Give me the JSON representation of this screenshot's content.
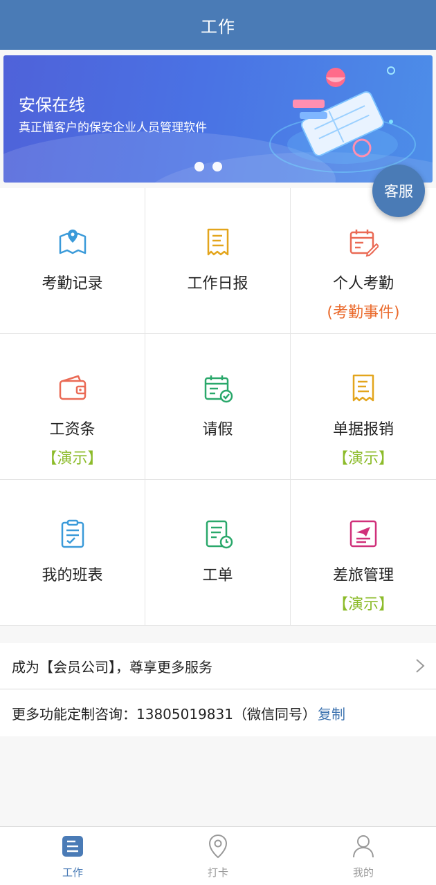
{
  "header": {
    "title": "工作"
  },
  "banner": {
    "title": "安保在线",
    "subtitle": "真正懂客户的保安企业人员管理软件",
    "slides": 2
  },
  "floating": {
    "kefu_label": "客服"
  },
  "grid": {
    "items": [
      {
        "label": "考勤记录",
        "icon": "map-pin-icon",
        "sub": ""
      },
      {
        "label": "工作日报",
        "icon": "report-doc-icon",
        "sub": ""
      },
      {
        "label": "个人考勤",
        "icon": "calendar-edit-icon",
        "sub": "(考勤事件)"
      },
      {
        "label": "工资条",
        "icon": "wallet-icon",
        "sub": "【演示】"
      },
      {
        "label": "请假",
        "icon": "calendar-check-icon",
        "sub": ""
      },
      {
        "label": "单据报销",
        "icon": "receipt-icon",
        "sub": "【演示】"
      },
      {
        "label": "我的班表",
        "icon": "clipboard-check-icon",
        "sub": ""
      },
      {
        "label": "工单",
        "icon": "work-order-clock-icon",
        "sub": ""
      },
      {
        "label": "差旅管理",
        "icon": "travel-plane-icon",
        "sub": "【演示】"
      }
    ]
  },
  "member": {
    "text": "成为【会员公司】，尊享更多服务"
  },
  "consult": {
    "text": "更多功能定制咨询：13805019831（微信同号）",
    "copy_label": "复制"
  },
  "tabbar": {
    "tabs": [
      {
        "label": "工作",
        "icon": "work-list-icon",
        "active": true
      },
      {
        "label": "打卡",
        "icon": "location-pin-icon",
        "active": false
      },
      {
        "label": "我的",
        "icon": "user-icon",
        "active": false
      }
    ]
  },
  "colors": {
    "primary": "#4a7bb6",
    "orange_sub": "#ea6a2c",
    "green_sub": "#8cbb2a",
    "link": "#3f74b0"
  }
}
